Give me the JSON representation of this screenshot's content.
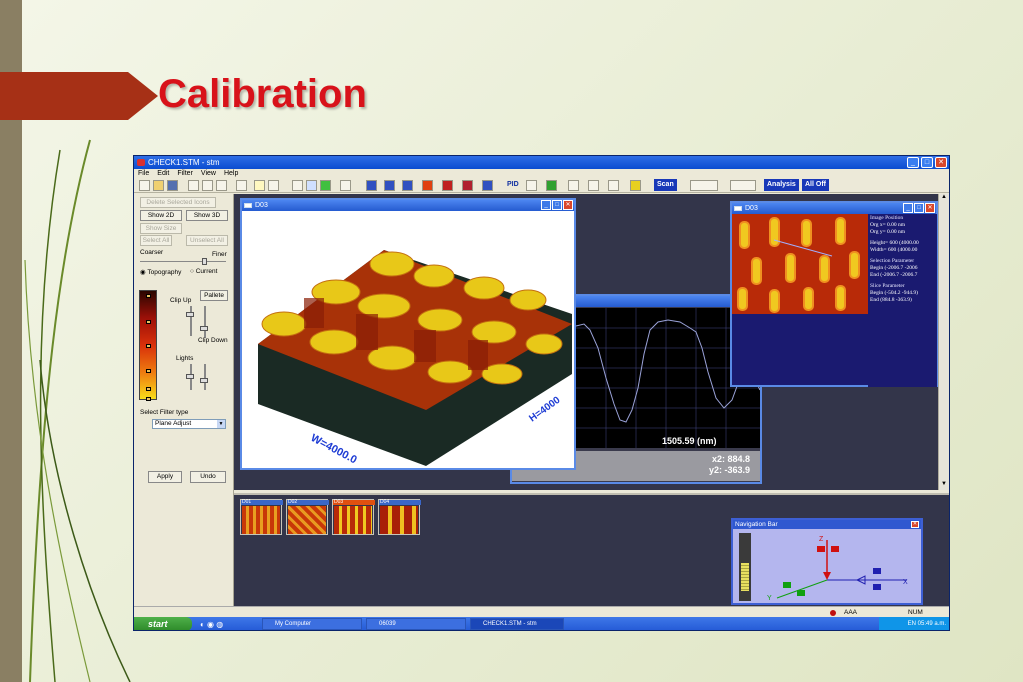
{
  "slide": {
    "title": "Calibration"
  },
  "app": {
    "title": "CHECK1.STM - stm",
    "menu": [
      "File",
      "Edit",
      "Filter",
      "View",
      "Help"
    ],
    "toolbar_text": [
      "PID",
      "Scan",
      "Analysis",
      "All Off"
    ],
    "left_panel": {
      "delete_selected": "Delete Selected Icons",
      "show2d": "Show 2D",
      "show3d": "Show 3D",
      "show_size": "Show Size",
      "select_all": "Select All",
      "unselect_all": "Unselect All",
      "coarser": "Coarser",
      "finer": "Finer",
      "topography": "Topography",
      "current": "Current",
      "clip_up": "Clip Up",
      "pallete": "Pallete",
      "clip_down": "Clip Down",
      "lights": "Lights",
      "filter_label": "Select Filter type",
      "filter_value": "Plane Adjust",
      "apply": "Apply",
      "undo": "Undo"
    },
    "win3d": {
      "title": "D03",
      "axis_w": "W=4000.0",
      "axis_h": "H=4000"
    },
    "profile": {
      "x_label": "1505.59 (nm)",
      "x2": "x2: 884.8",
      "y2": "y2: -363.9"
    },
    "win2d": {
      "title": "D03",
      "info": [
        "Image Position",
        "Org x= 0.00 nm",
        "Org y= 0.00 nm",
        "",
        "Height= 600 (4000.00",
        "Width= 600 (4000.00",
        "",
        "Selection Parameter",
        "Begin (-2006.7 -2006",
        "End (-2006.7 -2006.7",
        "",
        "Slice Parameter",
        "Begin (-504.2 -944.9)",
        "End (884.8 -363.9)"
      ]
    },
    "thumbs": [
      "D01",
      "D02",
      "D03",
      "D04"
    ],
    "nav": {
      "title": "Navigation Bar",
      "z": "Z",
      "x": "X",
      "y": "Y"
    },
    "status": {
      "aaa": "AAA",
      "num": "NUM"
    },
    "taskbar": {
      "start": "start",
      "tasks": [
        "My Computer",
        "06039",
        "CHECK1.STM - stm"
      ],
      "lang": "EN",
      "time": "05:49 a.m."
    }
  },
  "colors": {
    "title_red": "#d8121a",
    "xp_blue": "#245ad6",
    "workspace": "#33354a"
  }
}
